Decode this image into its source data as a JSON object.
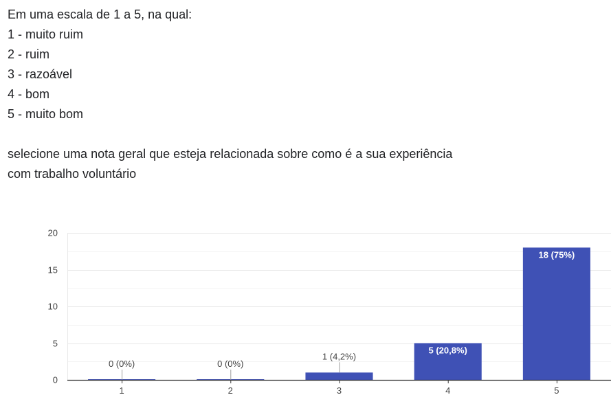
{
  "question": {
    "line1": "Em uma escala de 1 a 5, na qual:",
    "opt1": "1 - muito ruim",
    "opt2": "2 - ruim",
    "opt3": "3 - razoável",
    "opt4": "4 - bom",
    "opt5": "5 - muito bom",
    "line2": "selecione uma nota geral que esteja relacionada sobre como é a sua experiência",
    "line3": "com trabalho voluntário"
  },
  "colors": {
    "bar": "#3f51b5",
    "grid": "#e8e8e8",
    "axis": "#333333",
    "tick_text": "#444444"
  },
  "chart_data": {
    "type": "bar",
    "categories": [
      "1",
      "2",
      "3",
      "4",
      "5"
    ],
    "values": [
      0,
      0,
      1,
      5,
      18
    ],
    "data_labels": [
      "0 (0%)",
      "0 (0%)",
      "1 (4,2%)",
      "5 (20,8%)",
      "18 (75%)"
    ],
    "yticks": [
      0,
      5,
      10,
      15,
      20
    ],
    "ylim": [
      0,
      20
    ],
    "title": "",
    "xlabel": "",
    "ylabel": "",
    "grid": true
  }
}
